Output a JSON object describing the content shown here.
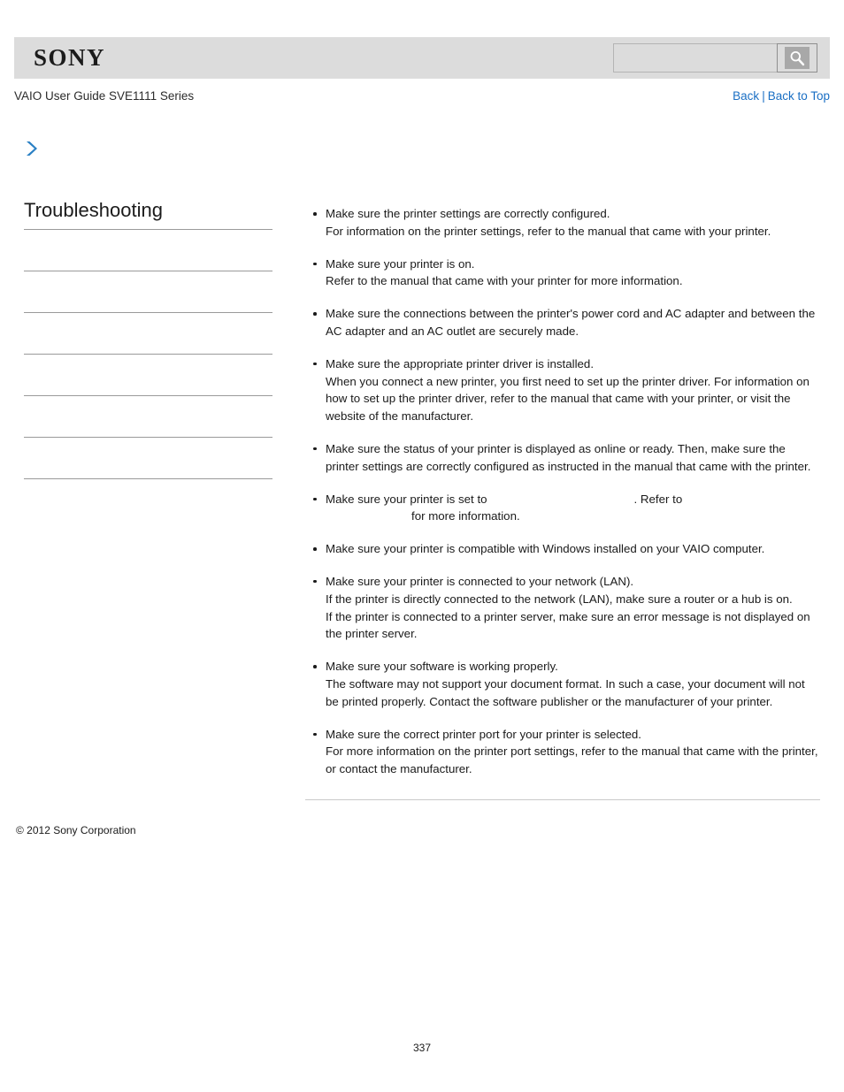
{
  "header": {
    "logo_text": "SONY",
    "search": {
      "value": "",
      "placeholder": "",
      "icon": "search-icon",
      "button_label": ""
    }
  },
  "subheader": {
    "guide_title": "VAIO User Guide SVE1111 Series",
    "links": [
      {
        "label": "Back"
      },
      {
        "label": "Back to Top"
      }
    ],
    "separator": "|"
  },
  "sidebar": {
    "expand_icon": "chevron-right-icon",
    "heading": "Troubleshooting",
    "items": [
      {
        "label": ""
      },
      {
        "label": ""
      },
      {
        "label": ""
      },
      {
        "label": ""
      },
      {
        "label": ""
      },
      {
        "label": ""
      }
    ]
  },
  "content": {
    "tips": [
      {
        "lines": [
          "Make sure the printer settings are correctly configured.",
          "For information on the printer settings, refer to the manual that came with your printer."
        ]
      },
      {
        "lines": [
          "Make sure your printer is on.",
          "Refer to the manual that came with your printer for more information."
        ]
      },
      {
        "lines": [
          "Make sure the connections between the printer's power cord and AC adapter and between the AC adapter and an AC outlet are securely made."
        ]
      },
      {
        "lines": [
          "Make sure the appropriate printer driver is installed.",
          "When you connect a new printer, you first need to set up the printer driver. For information on how to set up the printer driver, refer to the manual that came with your printer, or visit the website of the manufacturer."
        ]
      },
      {
        "lines": [
          "Make sure the status of your printer is displayed as online or ready. Then, make sure the printer settings are correctly configured as instructed in the manual that came with the printer."
        ]
      },
      {
        "is_split": true,
        "part_a": "Make sure your printer is set to",
        "link_a": "",
        "part_b": ". Refer to",
        "link_b": "",
        "part_c": "for more information."
      },
      {
        "lines": [
          "Make sure your printer is compatible with Windows installed on your VAIO computer."
        ]
      },
      {
        "lines": [
          "Make sure your printer is connected to your network (LAN).",
          "If the printer is directly connected to the network (LAN), make sure a router or a hub is on.",
          "If the printer is connected to a printer server, make sure an error message is not displayed on the printer server."
        ]
      },
      {
        "lines": [
          "Make sure your software is working properly.",
          "The software may not support your document format. In such a case, your document will not be printed properly. Contact the software publisher or the manufacturer of your printer."
        ]
      },
      {
        "lines": [
          "Make sure the correct printer port for your printer is selected.",
          "For more information on the printer port settings, refer to the manual that came with the printer, or contact the manufacturer."
        ]
      }
    ]
  },
  "footer": {
    "copyright": "© 2012 Sony Corporation",
    "page_number": "337"
  },
  "colors": {
    "header_bg": "#dcdcdc",
    "link_blue": "#1a6fc4",
    "chevron_blue": "#2a80c4",
    "divider": "#9a9a9a",
    "text": "#1a1a1a"
  }
}
